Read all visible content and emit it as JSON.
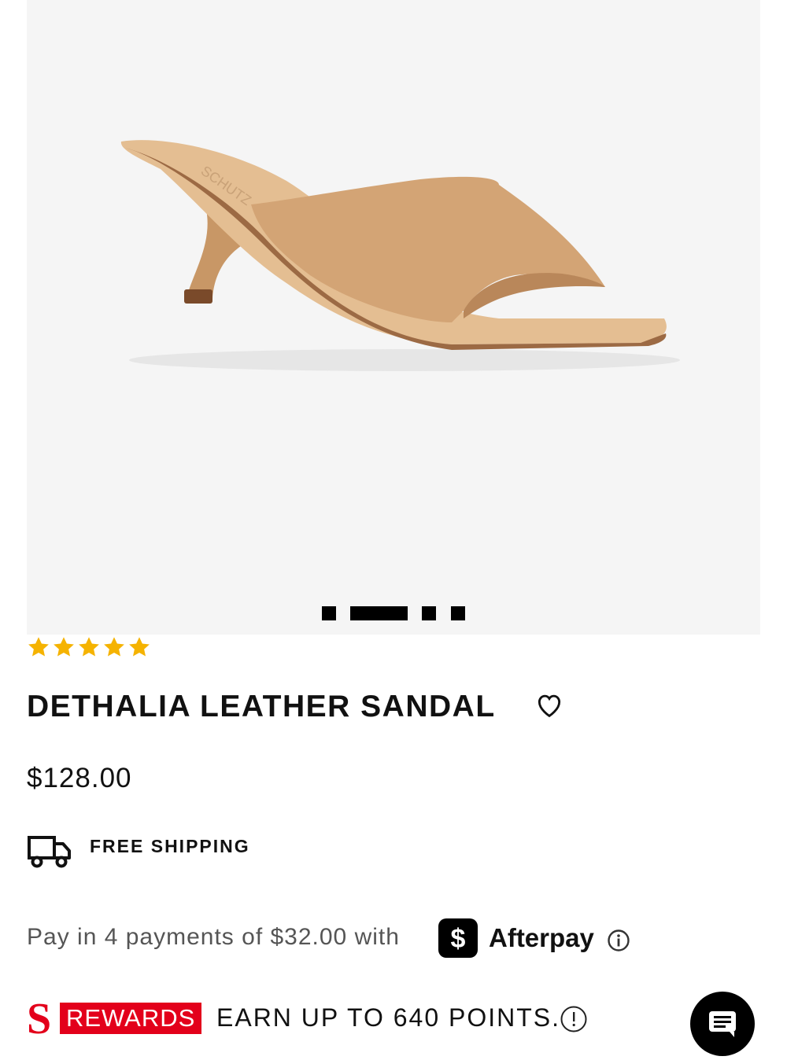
{
  "product": {
    "title": "DETHALIA LEATHER SANDAL",
    "price": "$128.00",
    "rating": 5,
    "rating_max": 5,
    "image_alt_icon": "sandal-image"
  },
  "gallery": {
    "slides_count": 4,
    "active_slide": 2
  },
  "shipping": {
    "label": "FREE SHIPPING",
    "icon": "truck-icon"
  },
  "afterpay": {
    "text": "Pay in 4 payments of $32.00 with",
    "brand": "Afterpay",
    "logo_icon": "afterpay-dollar-icon",
    "info_icon": "info-icon"
  },
  "rewards": {
    "logo_letter": "S",
    "badge": "REWARDS",
    "text": "EARN UP TO 640 POINTS.",
    "info_icon": "exclamation-info-icon"
  },
  "chat": {
    "icon": "chat-icon"
  },
  "colors": {
    "star": "#f5b301",
    "rewards_red": "#e3001b",
    "gallery_bg": "#f5f5f5",
    "shoe_tan": "#d8a978"
  }
}
